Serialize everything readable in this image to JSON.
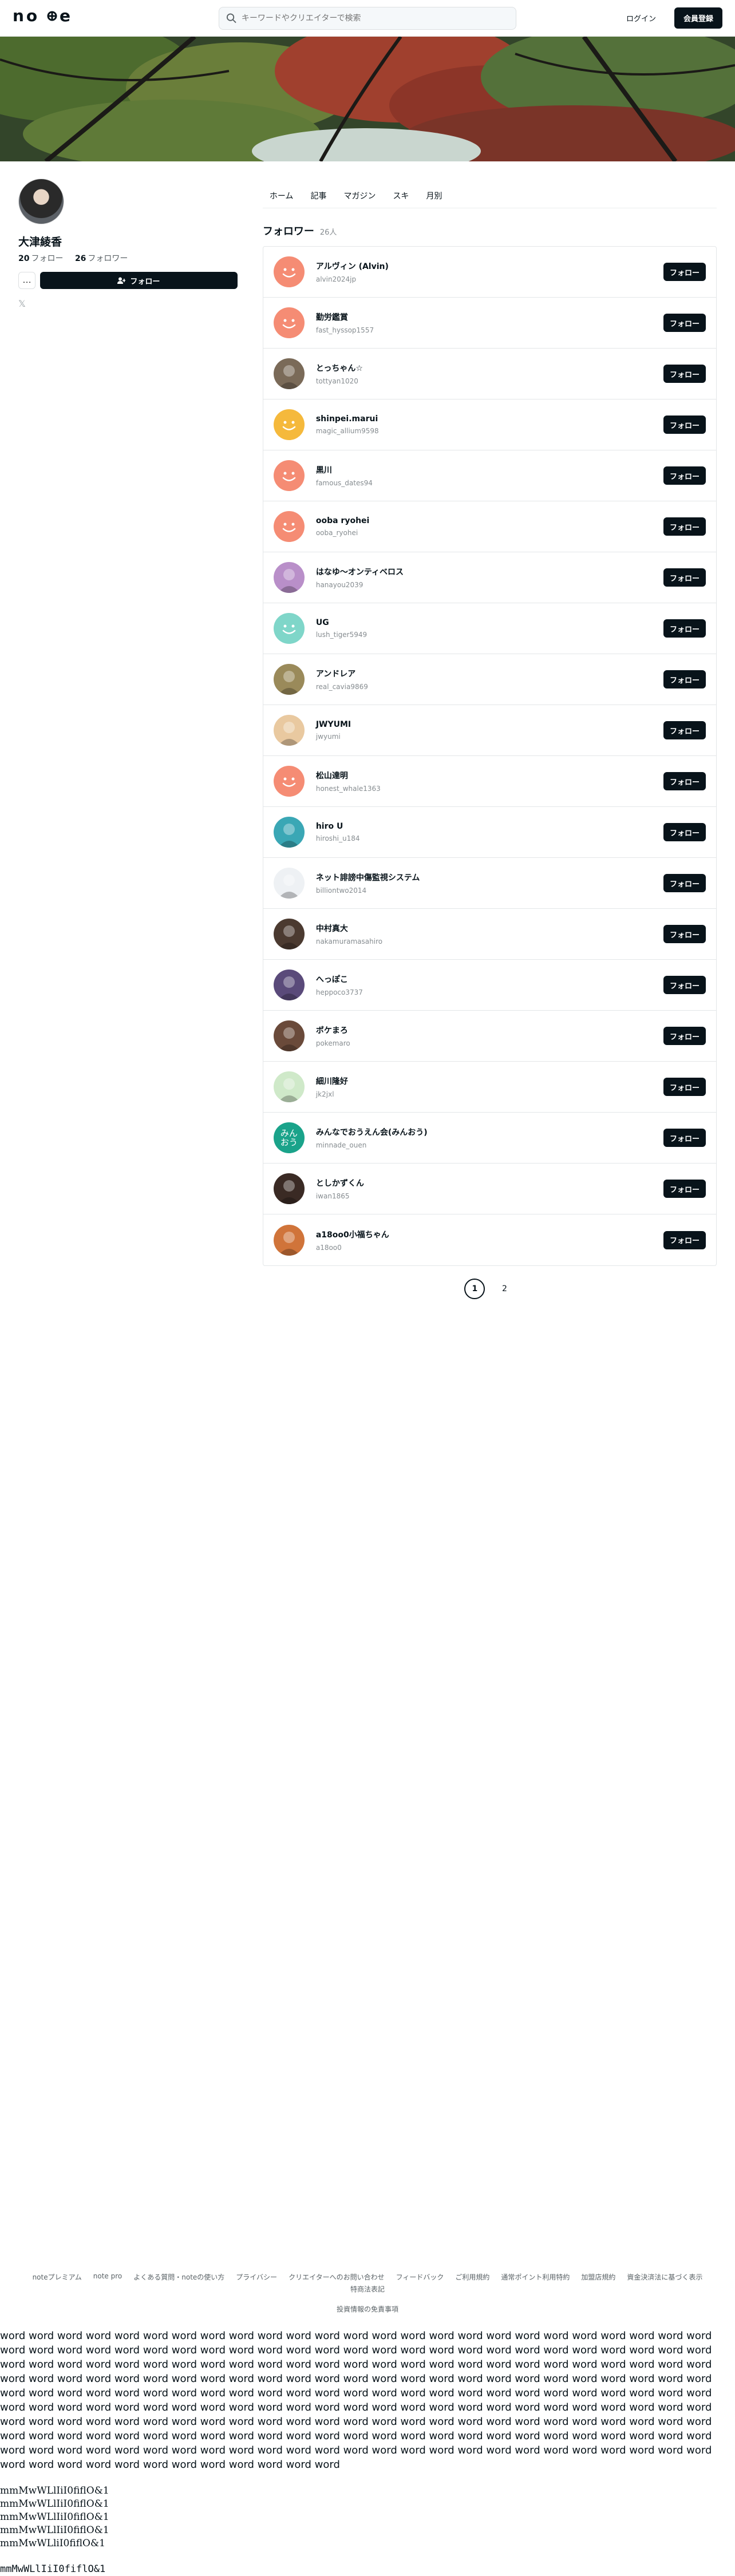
{
  "header": {
    "logo": "note",
    "search_placeholder": "キーワードやクリエイターで検索",
    "login": "ログイン",
    "signup": "会員登録"
  },
  "profile": {
    "name": "大津綾香",
    "following_count": "20",
    "following_label": "フォロー",
    "followers_count": "26",
    "followers_label": "フォロワー",
    "more": "…",
    "follow": "フォロー"
  },
  "tabs": [
    "ホーム",
    "記事",
    "マガジン",
    "スキ",
    "月別"
  ],
  "followers_section": {
    "title": "フォロワー",
    "count": "26人",
    "follow_button": "フォロー",
    "users": [
      {
        "name": "アルヴィン (Alvin)",
        "id": "alvin2024jp",
        "avatar": "smile",
        "color": "#f58c74"
      },
      {
        "name": "勤労鑑賞",
        "id": "fast_hyssop1557",
        "avatar": "smile",
        "color": "#f58c74"
      },
      {
        "name": "とっちゃん☆",
        "id": "tottyan1020",
        "avatar": "photo",
        "color": "#7a6a58"
      },
      {
        "name": "shinpei.marui",
        "id": "magic_allium9598",
        "avatar": "smile",
        "color": "#f5b93c"
      },
      {
        "name": "黒川",
        "id": "famous_dates94",
        "avatar": "smile",
        "color": "#f58c74"
      },
      {
        "name": "ooba ryohei",
        "id": "ooba_ryohei",
        "avatar": "smile",
        "color": "#f58c74"
      },
      {
        "name": "はなゆ〜オンティベロス",
        "id": "hanayou2039",
        "avatar": "photo",
        "color": "#b98fc9"
      },
      {
        "name": "UG",
        "id": "lush_tiger5949",
        "avatar": "smile",
        "color": "#7fd6c9"
      },
      {
        "name": "アンドレア",
        "id": "real_cavia9869",
        "avatar": "photo",
        "color": "#9a8a5a"
      },
      {
        "name": "JWYUMI",
        "id": "jwyumi",
        "avatar": "photo",
        "color": "#e9c9a0"
      },
      {
        "name": "松山達明",
        "id": "honest_whale1363",
        "avatar": "smile",
        "color": "#f58c74"
      },
      {
        "name": "hiro U",
        "id": "hiroshi_u184",
        "avatar": "photo",
        "color": "#3aa7b5"
      },
      {
        "name": "ネット誹謗中傷監視システム",
        "id": "billiontwo2014",
        "avatar": "photo",
        "color": "#eef1f4"
      },
      {
        "name": "中村真大",
        "id": "nakamuramasahiro",
        "avatar": "photo",
        "color": "#4b3a30"
      },
      {
        "name": "へっぽこ",
        "id": "heppoco3737",
        "avatar": "photo",
        "color": "#5a4a7a"
      },
      {
        "name": "ポケまろ",
        "id": "pokemaro",
        "avatar": "photo",
        "color": "#6a4a3a"
      },
      {
        "name": "細川隆好",
        "id": "jk2jxl",
        "avatar": "photo",
        "color": "#cfe9c9"
      },
      {
        "name": "みんなでおうえん会(みんおう)",
        "id": "minnade_ouen",
        "avatar": "text",
        "text": "みんおう",
        "color": "#1aa38a"
      },
      {
        "name": "としかずくん",
        "id": "iwan1865",
        "avatar": "photo",
        "color": "#3a2a24"
      },
      {
        "name": "a18oo0小福ちゃん",
        "id": "a18oo0",
        "avatar": "photo",
        "color": "#d0743a"
      }
    ]
  },
  "pager": {
    "current": "1",
    "next": "2"
  },
  "footer": {
    "links": [
      "noteプレミアム",
      "note pro",
      "よくある質問・noteの使い方",
      "プライバシー",
      "クリエイターへのお問い合わせ",
      "フィードバック",
      "ご利用規約",
      "通常ポイント利用特約",
      "加盟店規約",
      "資金決済法に基づく表示",
      "特商法表記"
    ],
    "sub": "投資情報の免責事項"
  },
  "extra": {
    "words": "word word word word word word word word word word word word word word word word word word word word word word word word word word word word word word word word word word word word word word word word word word word word word word word word word word word word word word word word word word word word word word word word word word word word word word word word word word word word word word word word word word word word word word word word word word word word word word word word word word word word word word word word word word word word word word word word word word word word word word word word word word word word word word word word word word word word word word word word word word word word word word word word word word word word word word word word word word word word word word word word word word word word word word word word word word word word word word word word word word word word word word word word word word word word word word word word word word word word word word word word word word word word word word word word word word word word word word word word word word word word word word word word word word word word word word word word word word word word word",
    "mono_lines": [
      "mmMwWLlIiI0fiflO&1",
      "mmMwWLlIiI0fiflO&1",
      "mmMwWLlIiI0fiflO&1",
      "mmMwWLlIiI0fiflO&1",
      "mmMwWLliI0fiflO&1"
    ],
    "mono_last": "mmMwWLlIiI0fiflO&1"
  }
}
